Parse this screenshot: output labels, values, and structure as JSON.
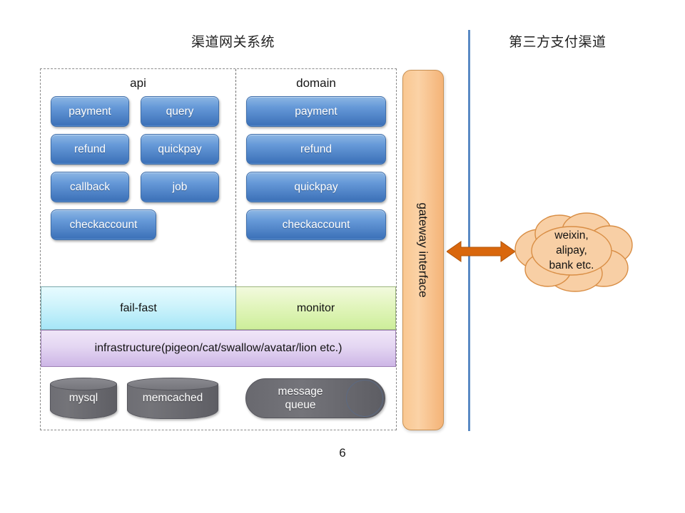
{
  "slide": {
    "page_number": "6",
    "title_left": "渠道网关系统",
    "title_right": "第三方支付渠道"
  },
  "colors": {
    "chip_blue_top": "#8cb6e4",
    "chip_blue_bottom": "#3d72b9",
    "failfast_band": "#a6e6f7",
    "monitor_band": "#cdee9a",
    "infrastructure_band": "#cdb6e6",
    "gateway_orange": "#f9c791",
    "arrow_orange": "#d9670d",
    "cloud_fill": "#f8cfa5",
    "cloud_stroke": "#d98e45",
    "divider_blue": "#5a8ac4",
    "storage_gray": "#6e6e74"
  },
  "system": {
    "api": {
      "title": "api",
      "rows": [
        [
          "payment",
          "query"
        ],
        [
          "refund",
          "quickpay"
        ],
        [
          "callback",
          "job"
        ]
      ],
      "wide_item": "checkaccount"
    },
    "domain": {
      "title": "domain",
      "items": [
        "payment",
        "refund",
        "quickpay",
        "checkaccount"
      ]
    },
    "band": {
      "left": "fail-fast",
      "right": "monitor"
    },
    "infrastructure": "infrastructure(pigeon/cat/swallow/avatar/lion etc.)",
    "storage": {
      "mysql": "mysql",
      "memcached": "memcached",
      "queue_line1": "message",
      "queue_line2": "queue"
    }
  },
  "gateway": {
    "label": "gateway interface"
  },
  "external": {
    "cloud_line1": "weixin,",
    "cloud_line2": "alipay,",
    "cloud_line3": "bank etc."
  }
}
